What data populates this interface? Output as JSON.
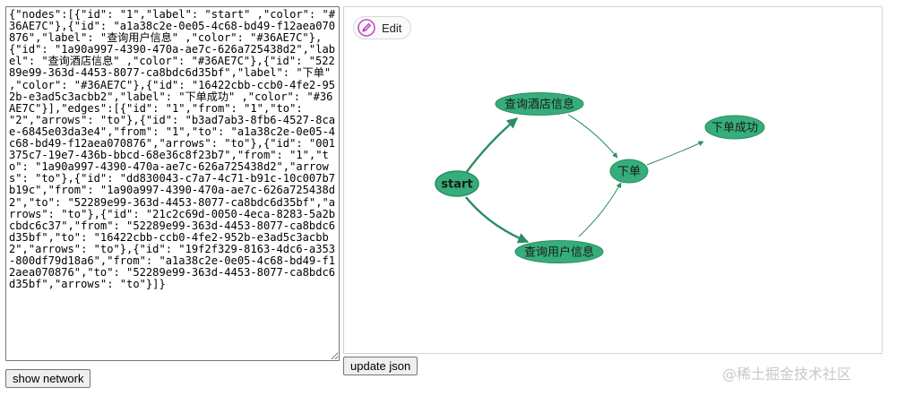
{
  "json_text": "{\"nodes\":[{\"id\": \"1\",\"label\": \"start\" ,\"color\": \"#36AE7C\"},{\"id\": \"a1a38c2e-0e05-4c68-bd49-f12aea070876\",\"label\": \"查询用户信息\" ,\"color\": \"#36AE7C\"},{\"id\": \"1a90a997-4390-470a-ae7c-626a725438d2\",\"label\": \"查询酒店信息\" ,\"color\": \"#36AE7C\"},{\"id\": \"52289e99-363d-4453-8077-ca8bdc6d35bf\",\"label\": \"下单\" ,\"color\": \"#36AE7C\"},{\"id\": \"16422cbb-ccb0-4fe2-952b-e3ad5c3acbb2\",\"label\": \"下单成功\" ,\"color\": \"#36AE7C\"}],\"edges\":[{\"id\": \"1\",\"from\": \"1\",\"to\": \"2\",\"arrows\": \"to\"},{\"id\": \"b3ad7ab3-8fb6-4527-8cae-6845e03da3e4\",\"from\": \"1\",\"to\": \"a1a38c2e-0e05-4c68-bd49-f12aea070876\",\"arrows\": \"to\"},{\"id\": \"001375c7-19e7-436b-bbcd-68e36c8f23b7\",\"from\": \"1\",\"to\": \"1a90a997-4390-470a-ae7c-626a725438d2\",\"arrows\": \"to\"},{\"id\": \"dd830043-c7a7-4c71-b91c-10c007b7b19c\",\"from\": \"1a90a997-4390-470a-ae7c-626a725438d2\",\"to\": \"52289e99-363d-4453-8077-ca8bdc6d35bf\",\"arrows\": \"to\"},{\"id\": \"21c2c69d-0050-4eca-8283-5a2bcbdc6c37\",\"from\": \"52289e99-363d-4453-8077-ca8bdc6d35bf\",\"to\": \"16422cbb-ccb0-4fe2-952b-e3ad5c3acbb2\",\"arrows\": \"to\"},{\"id\": \"19f2f329-8163-4dc6-a353-800df79d18a6\",\"from\": \"a1a38c2e-0e05-4c68-bd49-f12aea070876\",\"to\": \"52289e99-363d-4453-8077-ca8bdc6d35bf\",\"arrows\": \"to\"}]}",
  "buttons": {
    "show_network": "show network",
    "update_json": "update json",
    "edit": "Edit"
  },
  "network": {
    "node_color": "#36AE7C",
    "nodes": [
      {
        "key": "start",
        "label": "start"
      },
      {
        "key": "hotel",
        "label": "查询酒店信息"
      },
      {
        "key": "order",
        "label": "下单"
      },
      {
        "key": "success",
        "label": "下单成功"
      },
      {
        "key": "user",
        "label": "查询用户信息"
      }
    ]
  },
  "watermark": "@稀土掘金技术社区",
  "icons": {
    "edit": "pencil-icon"
  }
}
